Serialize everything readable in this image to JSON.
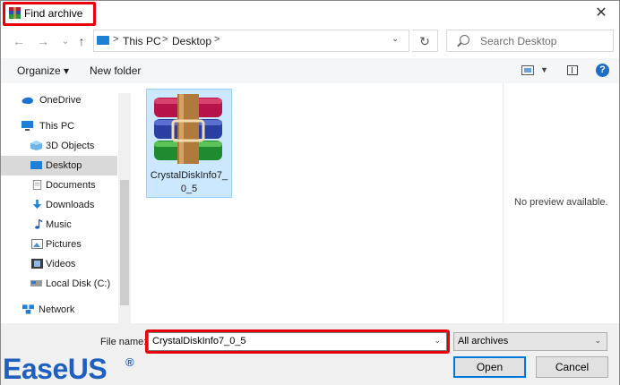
{
  "window": {
    "title": "Find archive",
    "close_glyph": "✕"
  },
  "navigation": {
    "back_glyph": "←",
    "forward_glyph": "→",
    "up_glyph": "↑",
    "breadcrumbs": [
      "This PC",
      "Desktop"
    ],
    "separator": ">",
    "refresh_glyph": "↻",
    "search_placeholder": "Search Desktop"
  },
  "toolbar": {
    "organize_label": "Organize ▾",
    "new_folder_label": "New folder",
    "help_glyph": "?"
  },
  "sidebar": {
    "items": [
      {
        "label": "OneDrive",
        "icon": "onedrive-icon"
      },
      {
        "label": "This PC",
        "icon": "computer-icon"
      },
      {
        "label": "3D Objects",
        "icon": "3d-objects-icon"
      },
      {
        "label": "Desktop",
        "icon": "desktop-icon",
        "selected": true
      },
      {
        "label": "Documents",
        "icon": "documents-icon"
      },
      {
        "label": "Downloads",
        "icon": "downloads-icon"
      },
      {
        "label": "Music",
        "icon": "music-icon"
      },
      {
        "label": "Pictures",
        "icon": "pictures-icon"
      },
      {
        "label": "Videos",
        "icon": "videos-icon"
      },
      {
        "label": "Local Disk (C:)",
        "icon": "drive-icon"
      },
      {
        "label": "Network",
        "icon": "network-icon"
      }
    ]
  },
  "files": [
    {
      "name_line1": "CrystalDiskInfo7_",
      "name_line2": "0_5",
      "icon": "winrar-archive-icon",
      "selected": true
    }
  ],
  "preview": {
    "text": "No preview available."
  },
  "footer": {
    "file_name_label": "File name:",
    "file_name_value": "CrystalDiskInfo7_0_5",
    "file_type_value": "All archives",
    "open_label": "Open",
    "cancel_label": "Cancel"
  },
  "watermark": {
    "brand_part1": "Ease",
    "brand_part2": "US",
    "registered": "®"
  },
  "colors": {
    "highlight_red": "#e8000b",
    "selection_blue": "#cce8ff",
    "accent": "#0078d7"
  }
}
